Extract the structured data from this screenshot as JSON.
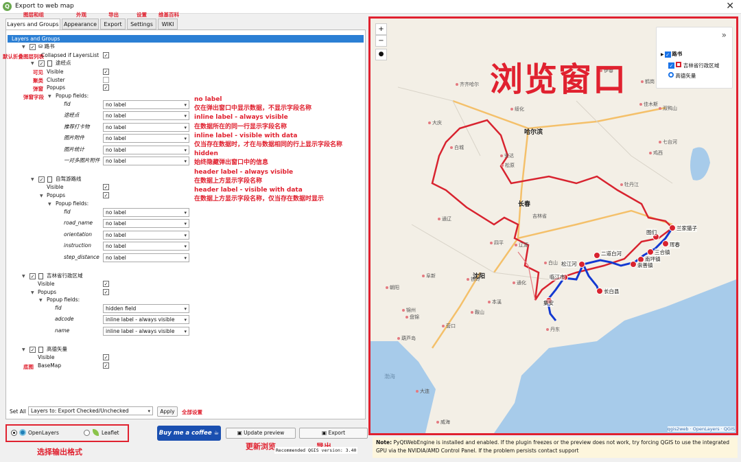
{
  "window": {
    "title": "Export to web map",
    "close": "✕"
  },
  "annotations": {
    "layers_groups": "图层和组",
    "appearance": "外观",
    "export": "导出",
    "settings": "设置",
    "wiki": "维基百科",
    "collapsed": "默认折叠图层列表",
    "visible": "可见",
    "cluster": "聚类",
    "popups": "弹窗",
    "popup_fields": "弹窗字段",
    "basemap": "底图",
    "set_all": "全部设置",
    "select_format": "选择输出格式",
    "update_preview": "更新浏览",
    "export_btn": "导出"
  },
  "tabs": [
    "Layers and Groups",
    "Appearance",
    "Export",
    "Settings",
    "WIKI"
  ],
  "tree": {
    "root": "Layers and Groups",
    "group1": "路书",
    "collapsed": "Collapsed if LayersList",
    "layer1": "途经点",
    "visible": "Visible",
    "cluster": "Cluster",
    "popups": "Popups",
    "popup_fields": "Popup fields:",
    "layer1_fields": [
      {
        "name": "fid",
        "value": "no label"
      },
      {
        "name": "途经点",
        "value": "no label"
      },
      {
        "name": "推荐打卡物",
        "value": "no label"
      },
      {
        "name": "图片附件",
        "value": "no label"
      },
      {
        "name": "图片统计",
        "value": "no label"
      },
      {
        "name": "一对多图片附件",
        "value": "no label"
      }
    ],
    "layer2": "自驾游路线",
    "layer2_fields": [
      {
        "name": "fid",
        "value": "no label"
      },
      {
        "name": "road_name",
        "value": "no label"
      },
      {
        "name": "orientation",
        "value": "no label"
      },
      {
        "name": "instruction",
        "value": "no label"
      },
      {
        "name": "step_distance",
        "value": "no label"
      }
    ],
    "layer3": "吉林省行政区域",
    "layer3_fields": [
      {
        "name": "fid",
        "value": "hidden field"
      },
      {
        "name": "adcode",
        "value": "inline label - always visible"
      },
      {
        "name": "name",
        "value": "inline label - always visible"
      }
    ],
    "layer4": "高德矢量",
    "basemap": "BaseMap"
  },
  "label_help": [
    "no label",
    "仅在弹出窗口中显示数据，不显示字段名称",
    "inline label - always visible",
    "在数据所在的同一行显示字段名称",
    "inline label - visible with data",
    "仅当存在数据时，才在与数据相同的行上显示字段名称",
    "hidden",
    "始终隐藏弹出窗口中的信息",
    "header label - always visible",
    "在数据上方显示字段名称",
    "header label - visible with data",
    "在数据上方显示字段名称，仅当存在数据时显示"
  ],
  "set_all": {
    "label": "Set All",
    "option": "Layers to: Export Checked/Unchecked",
    "apply": "Apply"
  },
  "format": {
    "openlayers": "OpenLayers",
    "leaflet": "Leaflet",
    "selected": "OpenLayers"
  },
  "buttons": {
    "coffee": "Buy me a coffee",
    "update": "Update preview",
    "export": "Export"
  },
  "version_text": "Recommended QGIS version: 3.40",
  "map": {
    "zoom_in": "+",
    "zoom_out": "−",
    "overlay_title": "浏览窗口",
    "legend_toggle": "»",
    "legend": {
      "group": "路书",
      "layer_admin": "吉林省行政区域",
      "basemap": "高德矢量"
    },
    "attribution": "qgis2web · OpenLayers · QGIS",
    "cities": [
      "哈尔滨",
      "长春",
      "沈阳"
    ],
    "province": "吉林省",
    "towns": [
      "伊春",
      "鹤岗",
      "齐齐哈尔",
      "绥化",
      "佳木斯",
      "双鸭山",
      "大庆",
      "七台河",
      "鸡西",
      "安达",
      "白城",
      "松原",
      "牡丹江",
      "通辽",
      "四平",
      "辽源",
      "通化",
      "铁岭",
      "阜新",
      "朝阳",
      "锦州",
      "鞍山",
      "本溪",
      "营口",
      "丹东",
      "盘锦",
      "葫芦岛",
      "大连",
      "威海",
      "白山"
    ],
    "sea_labels": [
      "渤海"
    ],
    "route_points": [
      "兰家猫子",
      "珲春",
      "图们",
      "三合镇",
      "南坪镇",
      "崇善镇",
      "二道白河",
      "松江河",
      "临江市",
      "长白县",
      "集安"
    ]
  },
  "note": {
    "bold": "Note:",
    "text": "PyQtWebEngine is installed and enabled. If the plugin freezes or the preview does not work, try forcing QGIS to use the integrated GPU via the NVIDIA/AMD Control Panel. If the problem persists contact support"
  }
}
